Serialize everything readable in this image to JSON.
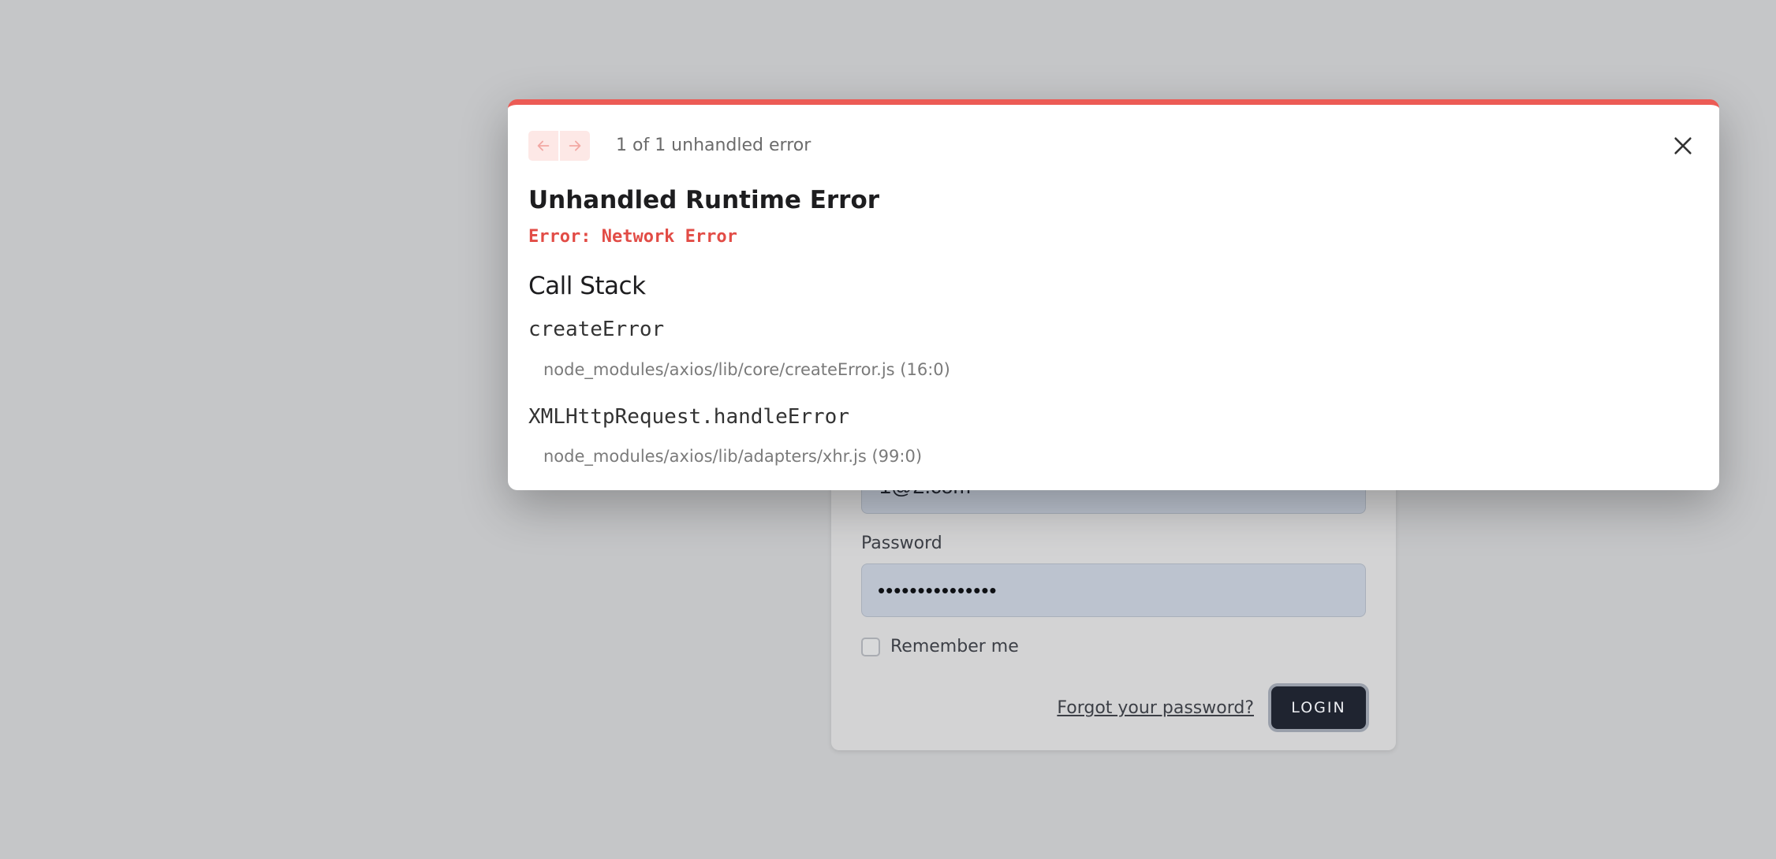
{
  "login_form": {
    "email_value": "1@2.com",
    "password_label": "Password",
    "password_value": "•••••••••••••••",
    "remember_label": "Remember me",
    "forgot_link": "Forgot your password?",
    "login_button": "LOGIN"
  },
  "error_overlay": {
    "accent_color": "#ec5b55",
    "nav": {
      "prev_icon": "arrow-left-icon",
      "next_icon": "arrow-right-icon"
    },
    "count_text": "1 of 1 unhandled error",
    "close_icon": "close-icon",
    "title": "Unhandled Runtime Error",
    "message": "Error: Network Error",
    "call_stack_heading": "Call Stack",
    "frames": [
      {
        "function": "createError",
        "location": "node_modules/axios/lib/core/createError.js (16:0)"
      },
      {
        "function": "XMLHttpRequest.handleError",
        "location": "node_modules/axios/lib/adapters/xhr.js (99:0)"
      }
    ]
  }
}
